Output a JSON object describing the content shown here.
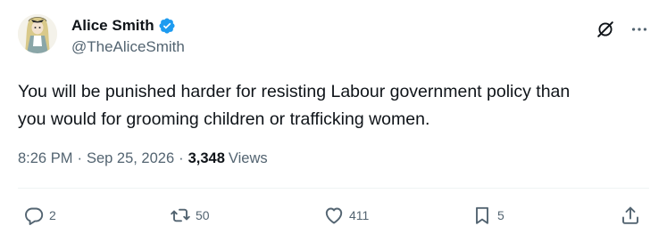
{
  "author": {
    "display_name": "Alice Smith",
    "handle": "@TheAliceSmith",
    "verified": true,
    "verified_color": "#1d9bf0"
  },
  "tweet": {
    "text": "You will be punished harder for resisting Labour government policy than\nyou would for grooming children or trafficking women.",
    "time": "8:26 PM",
    "separator": "·",
    "date": "Sep 25, 2026",
    "views_count": "3,348",
    "views_label": "Views"
  },
  "actions": {
    "reply_count": "2",
    "repost_count": "50",
    "like_count": "411",
    "bookmark_count": "5"
  },
  "icons": {
    "top": [
      "grok-icon",
      "more-icon"
    ],
    "bar": [
      "reply-icon",
      "repost-icon",
      "like-icon",
      "bookmark-icon",
      "share-icon"
    ]
  },
  "colors": {
    "text": "#0f1419",
    "secondary": "#536471",
    "divider": "#eff3f4"
  }
}
